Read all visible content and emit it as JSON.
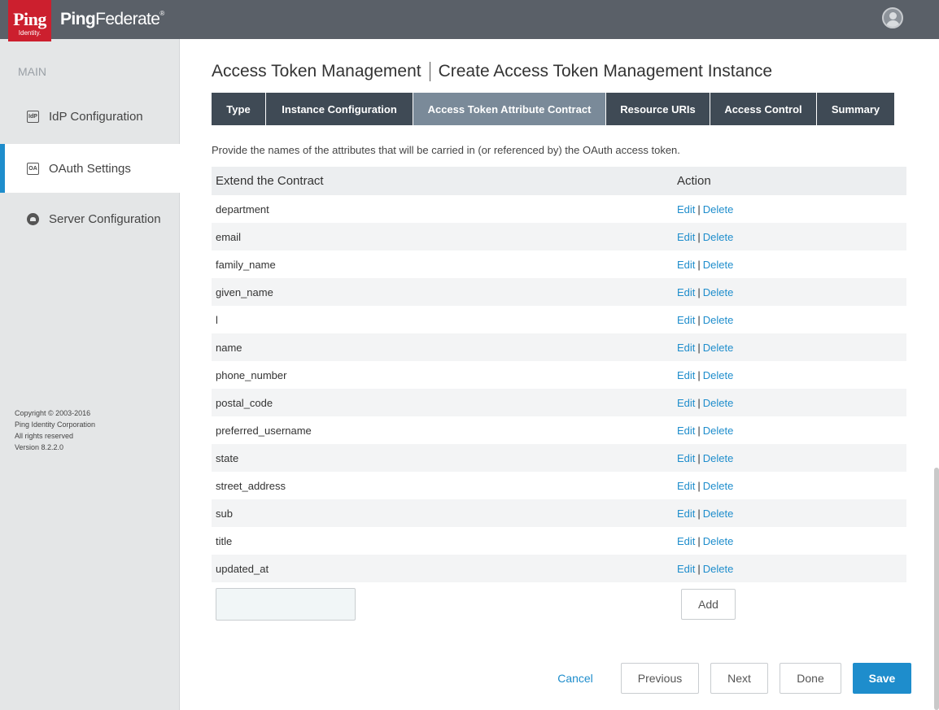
{
  "header": {
    "logo_text": "Ping",
    "logo_sub": "Identity.",
    "product_bold": "Ping",
    "product_light": "Federate",
    "product_mark": "®"
  },
  "sidebar": {
    "section": "MAIN",
    "items": [
      {
        "label": "IdP Configuration",
        "icon": "IdP"
      },
      {
        "label": "OAuth Settings",
        "icon": "OA"
      },
      {
        "label": "Server Configuration",
        "icon": "server-icon"
      }
    ],
    "copyright": [
      "Copyright © 2003-2016",
      "Ping Identity Corporation",
      "All rights reserved",
      "Version 8.2.2.0"
    ]
  },
  "page": {
    "title": "Access Token Management",
    "subtitle": "Create Access Token Management Instance",
    "description": "Provide the names of the attributes that will be carried in (or referenced by) the OAuth access token."
  },
  "tabs": [
    "Type",
    "Instance Configuration",
    "Access Token Attribute Contract",
    "Resource URIs",
    "Access Control",
    "Summary"
  ],
  "table": {
    "col_name": "Extend the Contract",
    "col_action": "Action",
    "edit_label": "Edit",
    "sep": "|",
    "delete_label": "Delete",
    "rows": [
      "department",
      "email",
      "family_name",
      "given_name",
      "l",
      "name",
      "phone_number",
      "postal_code",
      "preferred_username",
      "state",
      "street_address",
      "sub",
      "title",
      "updated_at"
    ]
  },
  "add": {
    "input_value": "",
    "button": "Add"
  },
  "footer": {
    "cancel": "Cancel",
    "previous": "Previous",
    "next": "Next",
    "done": "Done",
    "save": "Save"
  },
  "colors": {
    "accent": "#1e8dcc",
    "topbar": "#5a6068",
    "tab": "#3f4a55",
    "tab_active": "#7a8a99",
    "logo": "#cc1f2e"
  }
}
